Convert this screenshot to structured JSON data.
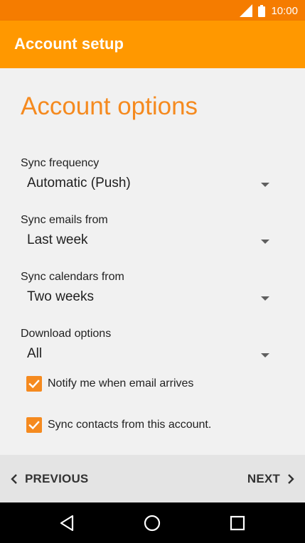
{
  "status_bar": {
    "time": "10:00",
    "icons": [
      "signal-icon",
      "battery-icon"
    ]
  },
  "app_bar": {
    "title": "Account setup",
    "color": "#ff9800"
  },
  "main": {
    "page_title": "Account options",
    "fields": [
      {
        "label": "Sync frequency",
        "value": "Automatic (Push)"
      },
      {
        "label": "Sync emails from",
        "value": "Last week"
      },
      {
        "label": "Sync calendars from",
        "value": "Two weeks"
      },
      {
        "label": "Download options",
        "value": "All"
      }
    ],
    "checkboxes": [
      {
        "label": "Notify me when email arrives",
        "checked": true
      },
      {
        "label": "Sync contacts from this account.",
        "checked": true
      }
    ]
  },
  "wizard": {
    "previous_label": "PREVIOUS",
    "next_label": "NEXT"
  },
  "system_nav": {
    "buttons": [
      "back-icon",
      "home-icon",
      "recents-icon"
    ]
  },
  "colors": {
    "accent": "#f58a1f",
    "status_bar": "#f57c00"
  }
}
